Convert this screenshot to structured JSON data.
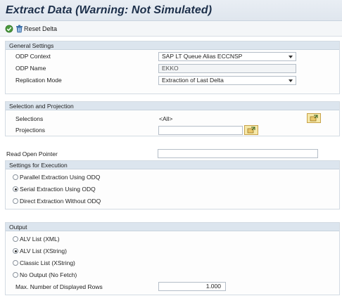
{
  "title": "Extract Data (Warning: Not Simulated)",
  "toolbar": {
    "execute_icon": "execute-icon",
    "reset_icon": "trash-icon",
    "reset_label": "Reset Delta"
  },
  "general": {
    "header": "General Settings",
    "odp_context_label": "ODP Context",
    "odp_context_value": "SAP LT Queue Alias ECCNSP",
    "odp_name_label": "ODP Name",
    "odp_name_value": "EKKO",
    "replication_mode_label": "Replication Mode",
    "replication_mode_value": "Extraction of Last Delta"
  },
  "selection": {
    "header": "Selection and Projection",
    "selections_label": "Selections",
    "selections_value": "<All>",
    "projections_label": "Projections",
    "projections_value": ""
  },
  "read_open_pointer": {
    "label": "Read Open Pointer",
    "value": ""
  },
  "execution": {
    "header": "Settings for Execution",
    "options": [
      {
        "label": "Parallel Extraction Using ODQ",
        "selected": false
      },
      {
        "label": "Serial Extraction Using ODQ",
        "selected": true
      },
      {
        "label": "Direct Extraction Without ODQ",
        "selected": false
      }
    ]
  },
  "output": {
    "header": "Output",
    "options": [
      {
        "label": "ALV List (XML)",
        "selected": false
      },
      {
        "label": "ALV List (XString)",
        "selected": true
      },
      {
        "label": "Classic List (XString)",
        "selected": false
      },
      {
        "label": "No Output (No Fetch)",
        "selected": false
      }
    ],
    "max_rows_label": "Max. Number of Displayed Rows",
    "max_rows_value": "1.000"
  },
  "colors": {
    "title_text": "#1c2f4a",
    "group_header_bg": "#dce5ee",
    "icon_button_bg": "#f6e8a8"
  }
}
